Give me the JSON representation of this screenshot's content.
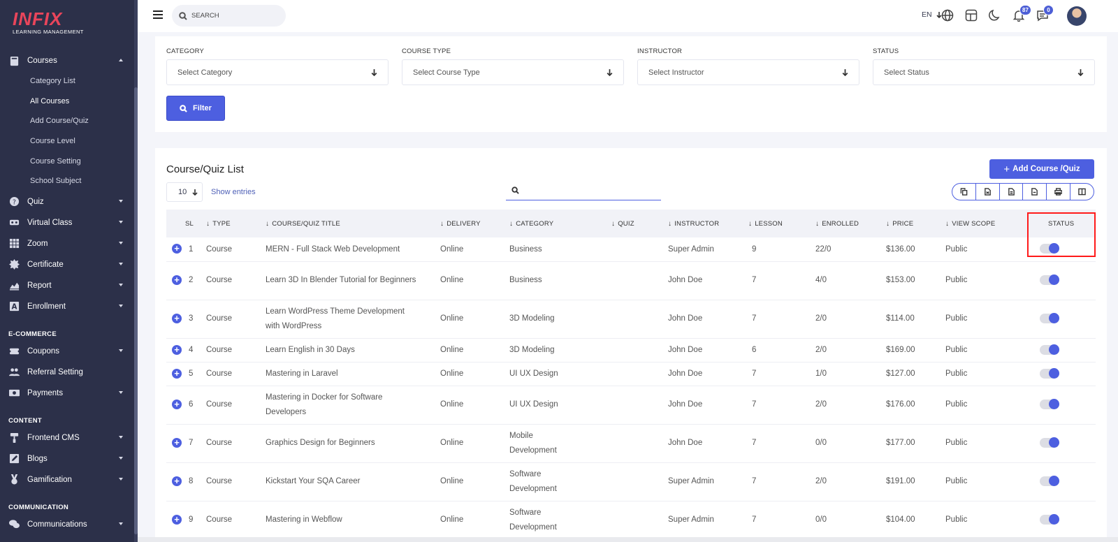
{
  "brand": {
    "logo_text": "INFIX",
    "logo_sub": "LEARNING MANAGEMENT"
  },
  "sidebar": {
    "courses": {
      "label": "Courses",
      "subitems": [
        "Category List",
        "All Courses",
        "Add Course/Quiz",
        "Course Level",
        "Course Setting",
        "School Subject"
      ]
    },
    "items_main": [
      "Quiz",
      "Virtual Class",
      "Zoom",
      "Certificate",
      "Report",
      "Enrollment"
    ],
    "section_ecommerce": "E-COMMERCE",
    "items_ecommerce": [
      "Coupons",
      "Referral Setting",
      "Payments"
    ],
    "section_content": "CONTENT",
    "items_content": [
      "Frontend CMS",
      "Blogs",
      "Gamification"
    ],
    "section_communication": "COMMUNICATION",
    "items_communication": [
      "Communications"
    ]
  },
  "header": {
    "search_placeholder": "SEARCH",
    "lang": "EN",
    "notifications_count": "87",
    "messages_count": "0"
  },
  "filter": {
    "category_label": "CATEGORY",
    "category_placeholder": "Select Category",
    "course_type_label": "COURSE TYPE",
    "course_type_placeholder": "Select Course Type",
    "instructor_label": "INSTRUCTOR",
    "instructor_placeholder": "Select Instructor",
    "status_label": "STATUS",
    "status_placeholder": "Select Status",
    "button": "Filter"
  },
  "list": {
    "title": "Course/Quiz List",
    "add_button": "Add Course /Quiz",
    "entries_value": "10",
    "show_entries": "Show entries",
    "columns": [
      "SL",
      "TYPE",
      "COURSE/QUIZ TITLE",
      "DELIVERY",
      "CATEGORY",
      "QUIZ",
      "INSTRUCTOR",
      "LESSON",
      "ENROLLED",
      "PRICE",
      "VIEW SCOPE",
      "STATUS"
    ],
    "rows": [
      {
        "sl": "1",
        "type": "Course",
        "title": "MERN - Full Stack Web Development",
        "delivery": "Online",
        "category": "Business",
        "quiz": "",
        "instructor": "Super Admin",
        "lesson": "9",
        "enrolled": "22/0",
        "price": "$136.00",
        "scope": "Public"
      },
      {
        "sl": "2",
        "type": "Course",
        "title": "Learn 3D In Blender Tutorial for Beginners",
        "delivery": "Online",
        "category": "Business",
        "quiz": "",
        "instructor": "John Doe",
        "lesson": "7",
        "enrolled": "4/0",
        "price": "$153.00",
        "scope": "Public"
      },
      {
        "sl": "3",
        "type": "Course",
        "title": "Learn WordPress Theme Development with WordPress",
        "delivery": "Online",
        "category": "3D Modeling",
        "quiz": "",
        "instructor": "John Doe",
        "lesson": "7",
        "enrolled": "2/0",
        "price": "$114.00",
        "scope": "Public"
      },
      {
        "sl": "4",
        "type": "Course",
        "title": "Learn English in 30 Days",
        "delivery": "Online",
        "category": "3D Modeling",
        "quiz": "",
        "instructor": "John Doe",
        "lesson": "6",
        "enrolled": "2/0",
        "price": "$169.00",
        "scope": "Public"
      },
      {
        "sl": "5",
        "type": "Course",
        "title": "Mastering in Laravel",
        "delivery": "Online",
        "category": "UI UX Design",
        "quiz": "",
        "instructor": "John Doe",
        "lesson": "7",
        "enrolled": "1/0",
        "price": "$127.00",
        "scope": "Public"
      },
      {
        "sl": "6",
        "type": "Course",
        "title": "Mastering in Docker for Software Developers",
        "delivery": "Online",
        "category": "UI UX Design",
        "quiz": "",
        "instructor": "John Doe",
        "lesson": "7",
        "enrolled": "2/0",
        "price": "$176.00",
        "scope": "Public"
      },
      {
        "sl": "7",
        "type": "Course",
        "title": "Graphics Design for Beginners",
        "delivery": "Online",
        "category": "Mobile Development",
        "quiz": "",
        "instructor": "John Doe",
        "lesson": "7",
        "enrolled": "0/0",
        "price": "$177.00",
        "scope": "Public"
      },
      {
        "sl": "8",
        "type": "Course",
        "title": "Kickstart Your SQA Career",
        "delivery": "Online",
        "category": "Software Development",
        "quiz": "",
        "instructor": "Super Admin",
        "lesson": "7",
        "enrolled": "2/0",
        "price": "$191.00",
        "scope": "Public"
      },
      {
        "sl": "9",
        "type": "Course",
        "title": "Mastering in Webflow",
        "delivery": "Online",
        "category": "Software Development",
        "quiz": "",
        "instructor": "Super Admin",
        "lesson": "7",
        "enrolled": "0/0",
        "price": "$104.00",
        "scope": "Public"
      }
    ]
  },
  "colors": {
    "sidebar_bg": "#2c3049",
    "accent": "#4d5fe0",
    "highlight": "#ff1a1a",
    "logo": "#e9455b"
  }
}
